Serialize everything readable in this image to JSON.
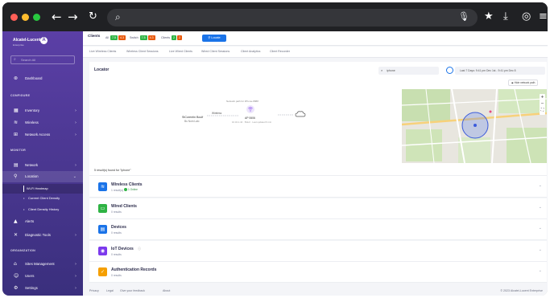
{
  "browser": {
    "back_icon": "←",
    "forward_icon": "→",
    "reload_icon": "↻",
    "search_icon": "⌕",
    "mic_icon": "🎙",
    "star_icon": "★",
    "download_icon": "⤓",
    "account_icon": "◎",
    "menu_icon": "≡",
    "traffic_colors": [
      "#ff5f57",
      "#febc2e",
      "#28c840"
    ]
  },
  "sidebar": {
    "brand": "Alcatel-Lucent",
    "brand_sub": "Enterprise",
    "brand_logo": "A",
    "search_placeholder": "Search All",
    "dashboard": "Dashboard",
    "sections": {
      "configure": "CONFIGURE",
      "monitor": "MONITOR",
      "organization": "ORGANIZATION"
    },
    "configure_items": [
      {
        "label": "Inventory",
        "icon": "inventory-icon",
        "glyph": "▦"
      },
      {
        "label": "Wireless",
        "icon": "wifi-icon",
        "glyph": "≋"
      },
      {
        "label": "Network Access",
        "icon": "network-access-icon",
        "glyph": "⊞"
      }
    ],
    "monitor_items": [
      {
        "label": "Network",
        "icon": "chart-icon",
        "glyph": "▤"
      },
      {
        "label": "Location",
        "icon": "location-pin-icon",
        "glyph": "⚲"
      }
    ],
    "location_sub": [
      "Wi-Fi Heatmap",
      "Current Client Density",
      "Client Density History"
    ],
    "after_items": [
      {
        "label": "Alerts",
        "icon": "alert-icon",
        "glyph": "▲"
      },
      {
        "label": "Diagnostic Tools",
        "icon": "tools-icon",
        "glyph": "✕"
      }
    ],
    "org_items": [
      {
        "label": "Sites Management",
        "icon": "sites-icon",
        "glyph": "⌂"
      },
      {
        "label": "Users",
        "icon": "users-icon",
        "glyph": "☺"
      },
      {
        "label": "Settings",
        "icon": "settings-icon",
        "glyph": "⚙"
      }
    ]
  },
  "topstrip": {
    "title": "Clients",
    "chips": [
      {
        "label": "All",
        "a": "7.5",
        "b": "4.3"
      },
      {
        "label": "Switch",
        "a": "7.5",
        "b": "4.3"
      },
      {
        "label": "Clients",
        "a": "2",
        "b": "2"
      }
    ],
    "locate_label": "Locate"
  },
  "subtabs": [
    "Live Wireless Clients",
    "Wireless Client Sessions",
    "Live Wired Clients",
    "Wired Client Sessions",
    "Client Analytics",
    "Client Recorder"
  ],
  "locator": {
    "title": "Locator",
    "search_value": "iphone",
    "time_range": "Last 7 Days: 9:41 pm Dec 1st - 9:41 pm Dec 8",
    "network_path_label": "Hide network path",
    "topo_left": "StCorentin Boulf",
    "topo_left_sub": "Bu Nom Lalo",
    "topo_link": "Wireless",
    "topo_ap_top": "Network path for iPhone-8888",
    "topo_ap": "AP 0606",
    "topo_ap_sub": "10.32.1.44 · 5GHz · Last updated 6 min"
  },
  "results": {
    "summary": "5 result(s) found for \"iphone\"",
    "rows": [
      {
        "title": "Wireless Clients",
        "count": "1 result(s)",
        "badge": "1 Online",
        "color": "#1a73e8",
        "icon": "wifi-icon",
        "glyph": "≋"
      },
      {
        "title": "Wired Clients",
        "count": "0 results",
        "badge": "",
        "color": "#2fb344",
        "icon": "wired-icon",
        "glyph": "▭"
      },
      {
        "title": "Devices",
        "count": "0 results",
        "badge": "",
        "color": "#1a73e8",
        "icon": "devices-icon",
        "glyph": "▤"
      },
      {
        "title": "IoT Devices",
        "count": "0 results",
        "badge": "",
        "color": "#7c3aed",
        "icon": "iot-icon",
        "glyph": "◉",
        "info": "ⓘ"
      },
      {
        "title": "Authentication Records",
        "count": "0 results",
        "badge": "",
        "color": "#f59f00",
        "icon": "auth-icon",
        "glyph": "✓"
      }
    ]
  },
  "footer": {
    "links": [
      "Privacy",
      "Legal",
      "Give your feedback",
      "About"
    ],
    "copyright": "© 2023 Alcatel-Lucent Enterprise"
  }
}
